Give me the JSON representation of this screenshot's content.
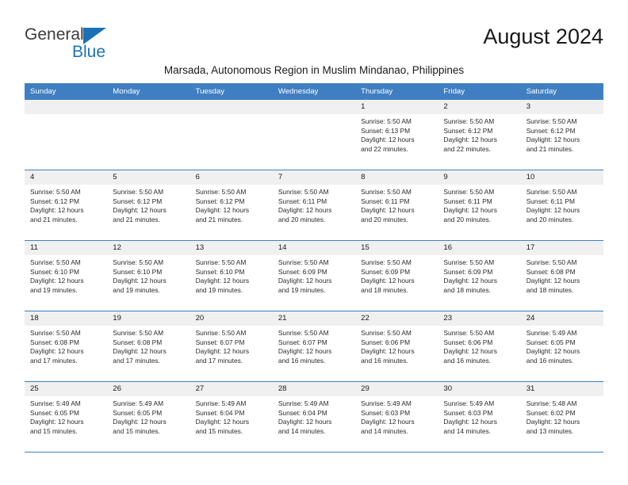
{
  "brand": {
    "word1": "General",
    "word2": "Blue",
    "triangle_color": "#1b71b8",
    "word1_color": "#3c3c3c",
    "word2_color": "#1b71b8"
  },
  "header": {
    "month_title": "August 2024",
    "subtitle": "Marsada, Autonomous Region in Muslim Mindanao, Philippines"
  },
  "theme": {
    "header_bg": "#3f7fc1",
    "header_text": "#ffffff",
    "daynum_bg": "#f0f0f0",
    "grid_line": "#3f7fc1",
    "cell_bg": "#ffffff",
    "body_text": "#2b2b2b"
  },
  "calendar": {
    "weekday_headers": [
      "Sunday",
      "Monday",
      "Tuesday",
      "Wednesday",
      "Thursday",
      "Friday",
      "Saturday"
    ],
    "weeks": [
      [
        {
          "day": "",
          "lines": []
        },
        {
          "day": "",
          "lines": []
        },
        {
          "day": "",
          "lines": []
        },
        {
          "day": "",
          "lines": []
        },
        {
          "day": "1",
          "lines": [
            "Sunrise: 5:50 AM",
            "Sunset: 6:13 PM",
            "Daylight: 12 hours",
            "and 22 minutes."
          ]
        },
        {
          "day": "2",
          "lines": [
            "Sunrise: 5:50 AM",
            "Sunset: 6:12 PM",
            "Daylight: 12 hours",
            "and 22 minutes."
          ]
        },
        {
          "day": "3",
          "lines": [
            "Sunrise: 5:50 AM",
            "Sunset: 6:12 PM",
            "Daylight: 12 hours",
            "and 21 minutes."
          ]
        }
      ],
      [
        {
          "day": "4",
          "lines": [
            "Sunrise: 5:50 AM",
            "Sunset: 6:12 PM",
            "Daylight: 12 hours",
            "and 21 minutes."
          ]
        },
        {
          "day": "5",
          "lines": [
            "Sunrise: 5:50 AM",
            "Sunset: 6:12 PM",
            "Daylight: 12 hours",
            "and 21 minutes."
          ]
        },
        {
          "day": "6",
          "lines": [
            "Sunrise: 5:50 AM",
            "Sunset: 6:12 PM",
            "Daylight: 12 hours",
            "and 21 minutes."
          ]
        },
        {
          "day": "7",
          "lines": [
            "Sunrise: 5:50 AM",
            "Sunset: 6:11 PM",
            "Daylight: 12 hours",
            "and 20 minutes."
          ]
        },
        {
          "day": "8",
          "lines": [
            "Sunrise: 5:50 AM",
            "Sunset: 6:11 PM",
            "Daylight: 12 hours",
            "and 20 minutes."
          ]
        },
        {
          "day": "9",
          "lines": [
            "Sunrise: 5:50 AM",
            "Sunset: 6:11 PM",
            "Daylight: 12 hours",
            "and 20 minutes."
          ]
        },
        {
          "day": "10",
          "lines": [
            "Sunrise: 5:50 AM",
            "Sunset: 6:11 PM",
            "Daylight: 12 hours",
            "and 20 minutes."
          ]
        }
      ],
      [
        {
          "day": "11",
          "lines": [
            "Sunrise: 5:50 AM",
            "Sunset: 6:10 PM",
            "Daylight: 12 hours",
            "and 19 minutes."
          ]
        },
        {
          "day": "12",
          "lines": [
            "Sunrise: 5:50 AM",
            "Sunset: 6:10 PM",
            "Daylight: 12 hours",
            "and 19 minutes."
          ]
        },
        {
          "day": "13",
          "lines": [
            "Sunrise: 5:50 AM",
            "Sunset: 6:10 PM",
            "Daylight: 12 hours",
            "and 19 minutes."
          ]
        },
        {
          "day": "14",
          "lines": [
            "Sunrise: 5:50 AM",
            "Sunset: 6:09 PM",
            "Daylight: 12 hours",
            "and 19 minutes."
          ]
        },
        {
          "day": "15",
          "lines": [
            "Sunrise: 5:50 AM",
            "Sunset: 6:09 PM",
            "Daylight: 12 hours",
            "and 18 minutes."
          ]
        },
        {
          "day": "16",
          "lines": [
            "Sunrise: 5:50 AM",
            "Sunset: 6:09 PM",
            "Daylight: 12 hours",
            "and 18 minutes."
          ]
        },
        {
          "day": "17",
          "lines": [
            "Sunrise: 5:50 AM",
            "Sunset: 6:08 PM",
            "Daylight: 12 hours",
            "and 18 minutes."
          ]
        }
      ],
      [
        {
          "day": "18",
          "lines": [
            "Sunrise: 5:50 AM",
            "Sunset: 6:08 PM",
            "Daylight: 12 hours",
            "and 17 minutes."
          ]
        },
        {
          "day": "19",
          "lines": [
            "Sunrise: 5:50 AM",
            "Sunset: 6:08 PM",
            "Daylight: 12 hours",
            "and 17 minutes."
          ]
        },
        {
          "day": "20",
          "lines": [
            "Sunrise: 5:50 AM",
            "Sunset: 6:07 PM",
            "Daylight: 12 hours",
            "and 17 minutes."
          ]
        },
        {
          "day": "21",
          "lines": [
            "Sunrise: 5:50 AM",
            "Sunset: 6:07 PM",
            "Daylight: 12 hours",
            "and 16 minutes."
          ]
        },
        {
          "day": "22",
          "lines": [
            "Sunrise: 5:50 AM",
            "Sunset: 6:06 PM",
            "Daylight: 12 hours",
            "and 16 minutes."
          ]
        },
        {
          "day": "23",
          "lines": [
            "Sunrise: 5:50 AM",
            "Sunset: 6:06 PM",
            "Daylight: 12 hours",
            "and 16 minutes."
          ]
        },
        {
          "day": "24",
          "lines": [
            "Sunrise: 5:49 AM",
            "Sunset: 6:05 PM",
            "Daylight: 12 hours",
            "and 16 minutes."
          ]
        }
      ],
      [
        {
          "day": "25",
          "lines": [
            "Sunrise: 5:49 AM",
            "Sunset: 6:05 PM",
            "Daylight: 12 hours",
            "and 15 minutes."
          ]
        },
        {
          "day": "26",
          "lines": [
            "Sunrise: 5:49 AM",
            "Sunset: 6:05 PM",
            "Daylight: 12 hours",
            "and 15 minutes."
          ]
        },
        {
          "day": "27",
          "lines": [
            "Sunrise: 5:49 AM",
            "Sunset: 6:04 PM",
            "Daylight: 12 hours",
            "and 15 minutes."
          ]
        },
        {
          "day": "28",
          "lines": [
            "Sunrise: 5:49 AM",
            "Sunset: 6:04 PM",
            "Daylight: 12 hours",
            "and 14 minutes."
          ]
        },
        {
          "day": "29",
          "lines": [
            "Sunrise: 5:49 AM",
            "Sunset: 6:03 PM",
            "Daylight: 12 hours",
            "and 14 minutes."
          ]
        },
        {
          "day": "30",
          "lines": [
            "Sunrise: 5:49 AM",
            "Sunset: 6:03 PM",
            "Daylight: 12 hours",
            "and 14 minutes."
          ]
        },
        {
          "day": "31",
          "lines": [
            "Sunrise: 5:48 AM",
            "Sunset: 6:02 PM",
            "Daylight: 12 hours",
            "and 13 minutes."
          ]
        }
      ]
    ]
  }
}
